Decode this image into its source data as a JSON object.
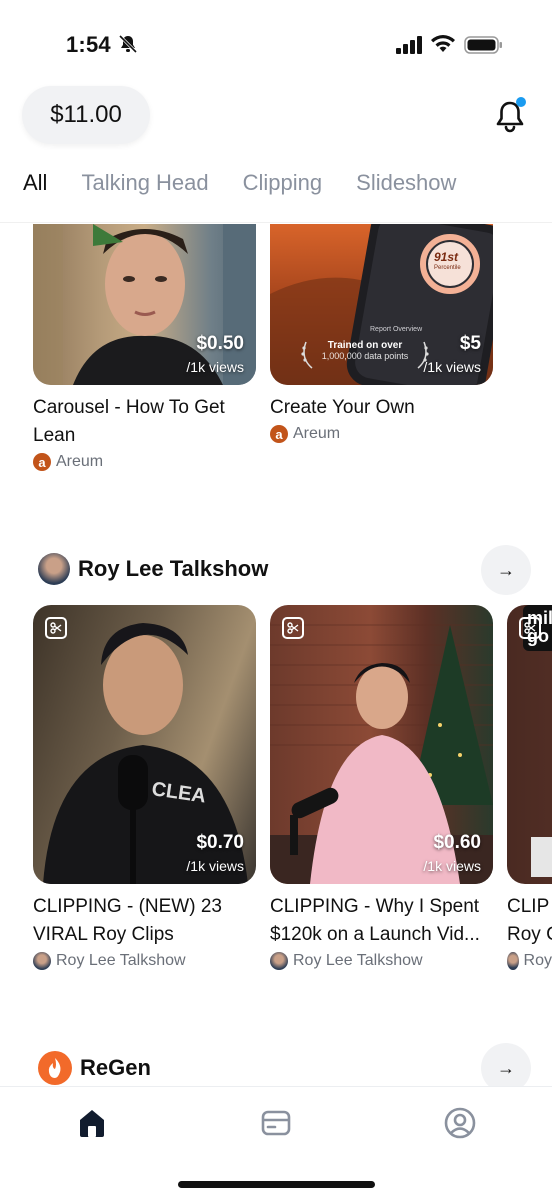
{
  "status_bar": {
    "time": "1:54"
  },
  "header": {
    "balance": "$11.00"
  },
  "tabs": [
    {
      "label": "All",
      "active": true
    },
    {
      "label": "Talking Head",
      "active": false
    },
    {
      "label": "Clipping",
      "active": false
    },
    {
      "label": "Slideshow",
      "active": false
    }
  ],
  "top_row": [
    {
      "title": "Carousel - How To Get Lean",
      "author": "Areum",
      "price": "$0.50",
      "per": "/1k views"
    },
    {
      "title": "Create Your Own",
      "author": "Areum",
      "price": "$5",
      "per": "/1k views",
      "overlay": {
        "score": "91st",
        "score_sub": "Percentile",
        "report": "Report Overview",
        "trained_line1": "Trained on over",
        "trained_line2": "1,000,000 data points"
      }
    }
  ],
  "section_roy": {
    "title": "Roy Lee Talkshow",
    "cards": [
      {
        "title": "CLIPPING - (NEW) 23 VIRAL Roy Clips",
        "author": "Roy Lee Talkshow",
        "price": "$0.70",
        "per": "/1k views"
      },
      {
        "title": "CLIPPING - Why I Spent $120k on a Launch Vid...",
        "author": "Roy Lee Talkshow",
        "price": "$0.60",
        "per": "/1k views"
      },
      {
        "title": "CLIP",
        "title2": "Roy C",
        "author": "Roy",
        "overlay_text": "mil go"
      }
    ]
  },
  "section_regen": {
    "title": "ReGen"
  },
  "bottom_nav": [
    {
      "name": "home-icon",
      "active": true
    },
    {
      "name": "wallet-icon",
      "active": false
    },
    {
      "name": "profile-icon",
      "active": false
    }
  ],
  "colors": {
    "accent": "#1a9bf0",
    "text": "#111111",
    "muted": "#8a919e",
    "regen": "#f26a2a"
  }
}
